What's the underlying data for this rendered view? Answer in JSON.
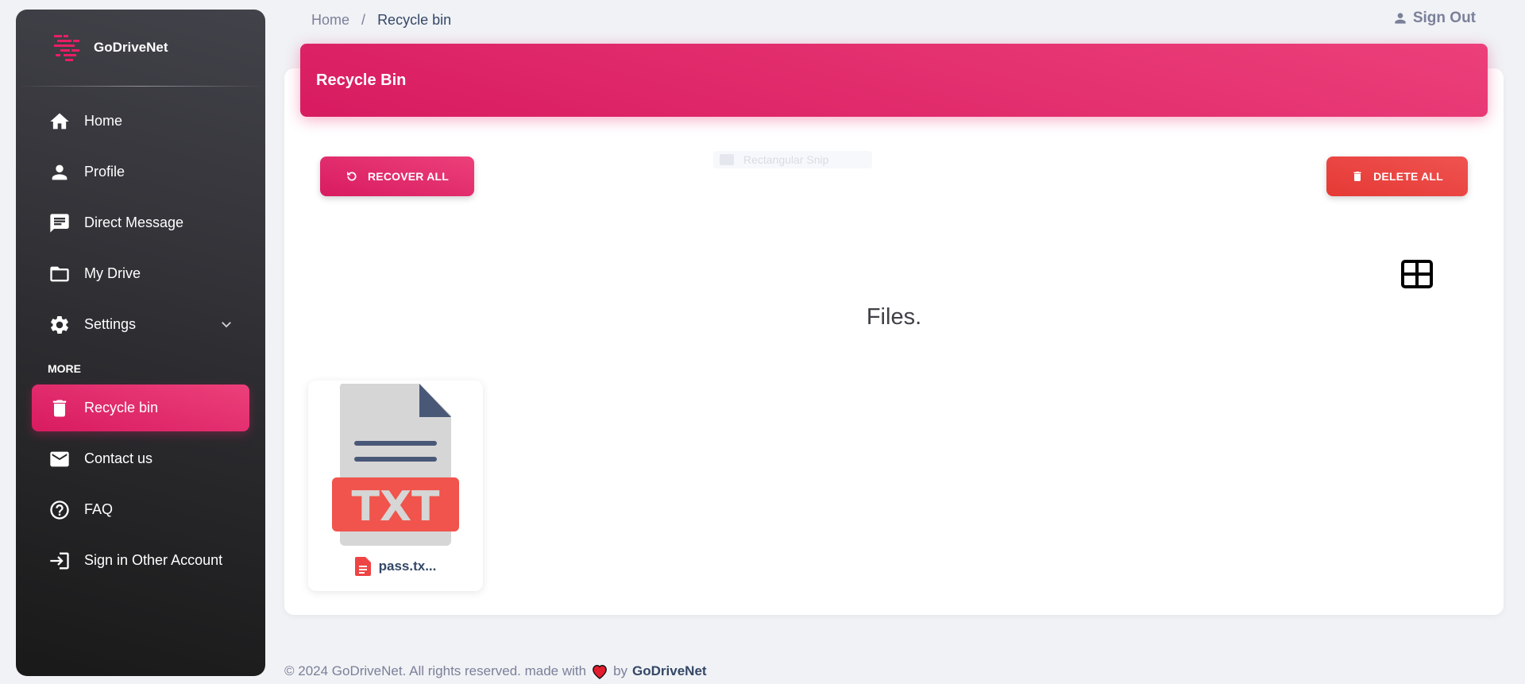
{
  "brand": {
    "name": "GoDriveNet"
  },
  "sidebar": {
    "items": [
      {
        "label": "Home",
        "icon": "home-icon"
      },
      {
        "label": "Profile",
        "icon": "person-icon"
      },
      {
        "label": "Direct Message",
        "icon": "chat-icon"
      },
      {
        "label": "My Drive",
        "icon": "folder-icon"
      },
      {
        "label": "Settings",
        "icon": "gear-icon"
      }
    ],
    "more_title": "MORE",
    "more_items": [
      {
        "label": "Recycle bin",
        "icon": "trash-icon",
        "active": true
      },
      {
        "label": "Contact us",
        "icon": "mail-icon"
      },
      {
        "label": "FAQ",
        "icon": "help-icon"
      },
      {
        "label": "Sign in Other Account",
        "icon": "login-icon"
      }
    ]
  },
  "breadcrumb": {
    "home": "Home",
    "separator": "/",
    "current": "Recycle bin"
  },
  "header": {
    "signout_label": "Sign Out"
  },
  "main": {
    "title": "Recycle Bin",
    "recover_all_label": "RECOVER ALL",
    "delete_all_label": "DELETE ALL",
    "ghost_label": "Rectangular Snip",
    "files_heading": "Files.",
    "files": [
      {
        "name": "pass.tx...",
        "type": "TXT"
      }
    ]
  },
  "footer": {
    "text": "© 2024 GoDriveNet. All rights reserved. made with",
    "by": "by",
    "brand": "GoDriveNet"
  },
  "colors": {
    "accent": "#e91e63",
    "danger": "#e53935",
    "sidebar_dark": "#191919"
  }
}
